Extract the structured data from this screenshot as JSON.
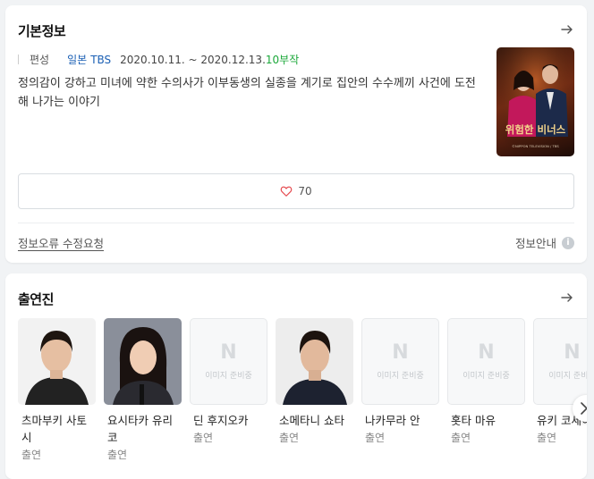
{
  "basic_info": {
    "title": "기본정보",
    "meta_label": "편성",
    "country": "일본",
    "network": "TBS",
    "dates": "2020.10.11. ~ 2020.12.13.",
    "episodes": "10부작",
    "description": "정의감이 강하고 미녀에 약한 수의사가 이부동생의 실종을 계기로 집안의 수수께끼 사건에 도전해 나가는 이야기",
    "poster_title": "위험한 비너스",
    "poster_credit": "©NIPPON TELEVISION / TBS",
    "like_count": "70",
    "report_link": "정보오류 수정요청",
    "info_link": "정보안내"
  },
  "cast_section": {
    "title": "출연진",
    "placeholder_text": "이미지 준비중",
    "placeholder_logo": "N",
    "members": [
      {
        "name": "츠마부키 사토시",
        "role": "출연",
        "has_photo": true
      },
      {
        "name": "요시타카 유리코",
        "role": "출연",
        "has_photo": true
      },
      {
        "name": "딘 후지오카",
        "role": "출연",
        "has_photo": false
      },
      {
        "name": "소메타니 쇼타",
        "role": "출연",
        "has_photo": true
      },
      {
        "name": "나카무라 안",
        "role": "출연",
        "has_photo": false
      },
      {
        "name": "홋타 마유",
        "role": "출연",
        "has_photo": false
      },
      {
        "name": "유키 코세이",
        "role": "출연",
        "has_photo": false
      }
    ]
  },
  "colors": {
    "link_blue": "#1a5fb4",
    "episodes_green": "#1ba83a",
    "heart_red": "#e5484d"
  }
}
